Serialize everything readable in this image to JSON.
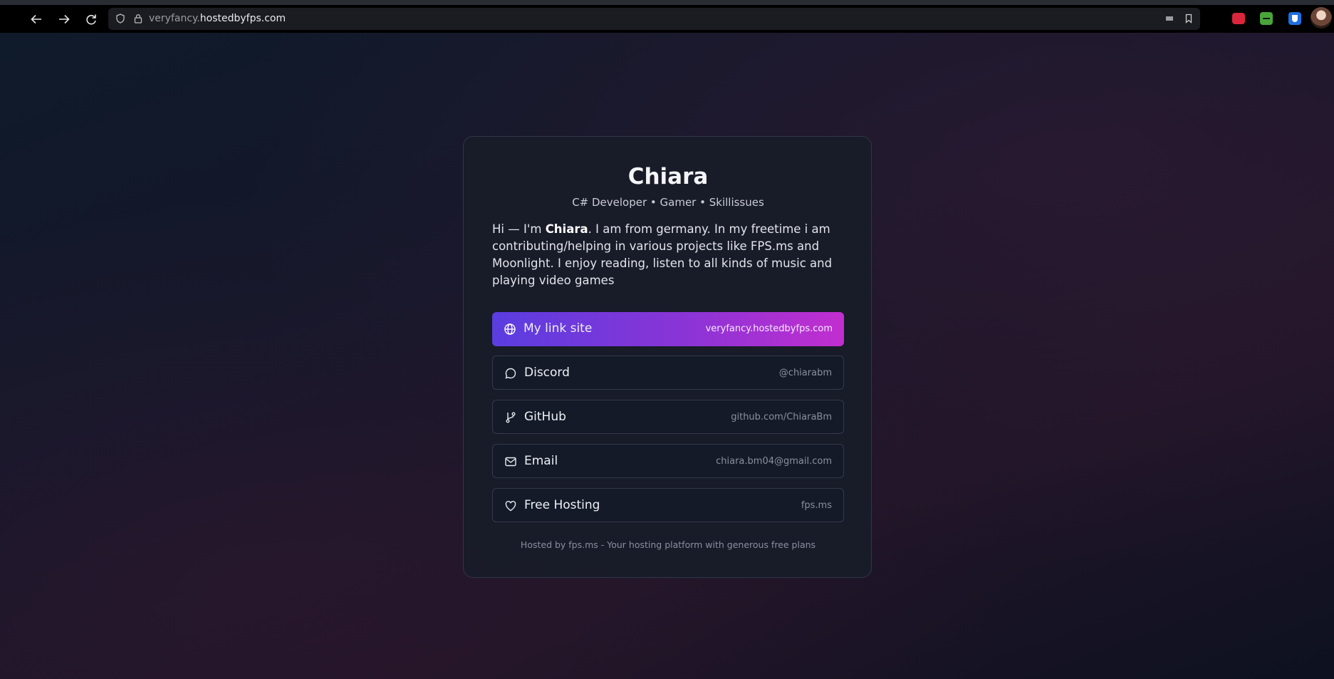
{
  "browser": {
    "url_prefix": "veryfancy.",
    "url_domain": "hostedbyfps.com"
  },
  "profile": {
    "name": "Chiara",
    "tagline": "C# Developer • Gamer • Skillissues",
    "bio_start": "Hi — I'm ",
    "bio_name": "Chiara",
    "bio_rest": ". I am from germany. In my freetime i am contributing/helping in various projects like FPS.ms and Moonlight. I enjoy reading, listen to all kinds of music and playing video games"
  },
  "links": [
    {
      "label": "My link site",
      "value": "veryfancy.hostedbyfps.com",
      "icon": "globe-icon"
    },
    {
      "label": "Discord",
      "value": "@chiarabm",
      "icon": "chat-bubble-icon"
    },
    {
      "label": "GitHub",
      "value": "github.com/ChiaraBm",
      "icon": "git-branch-icon"
    },
    {
      "label": "Email",
      "value": "chiara.bm04@gmail.com",
      "icon": "mail-icon"
    },
    {
      "label": "Free Hosting",
      "value": "fps.ms",
      "icon": "heart-icon"
    }
  ],
  "footer": "Hosted by fps.ms - Your hosting platform with generous free plans",
  "colors": {
    "accent_start": "#5a3de0",
    "accent_end": "#c22ecf",
    "card_bg": "#181c28"
  }
}
